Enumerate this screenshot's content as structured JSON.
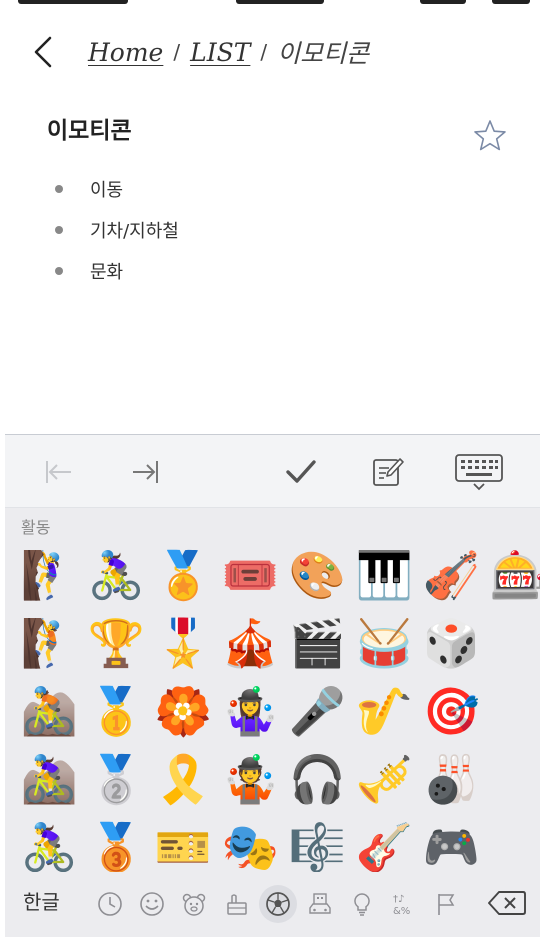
{
  "nav": {
    "breadcrumb_home": "Home",
    "breadcrumb_list": "LIST",
    "separator": "/",
    "breadcrumb_current": "이모티콘"
  },
  "content": {
    "title": "이모티콘",
    "items": [
      "이동",
      "기차/지하철",
      "문화"
    ]
  },
  "keyboard": {
    "category_label": "활동",
    "emojis": [
      [
        "🧗‍♀️",
        "🚴‍♀️",
        "🏅",
        "🎟️",
        "🎨",
        "🎹",
        "🎻",
        "🎰"
      ],
      [
        "🧗",
        "🏆",
        "🎖️",
        "🎪",
        "🎬",
        "🥁",
        "🎲"
      ],
      [
        "🚵",
        "🥇",
        "🏵️",
        "🤹‍♀️",
        "🎤",
        "🎷",
        "🎯"
      ],
      [
        "🚵‍♀️",
        "🥈",
        "🎗️",
        "🤹",
        "🎧",
        "🎺",
        "🎳"
      ],
      [
        "🚴‍♀️",
        "🥉",
        "🎫",
        "🎭",
        "🎼",
        "🎸",
        "🎮"
      ]
    ],
    "hangul_label": "한글",
    "categories": [
      "recent-clock",
      "smiley",
      "animal",
      "food",
      "activity-soccer",
      "travel-building",
      "objects-bulb",
      "symbols",
      "flags"
    ],
    "active_category": "activity-soccer"
  },
  "colors": {
    "accent": "#333333",
    "keyboard_bg": "#ececef",
    "toolbar_bg": "#f3f4f6",
    "muted": "#8e8e93"
  }
}
